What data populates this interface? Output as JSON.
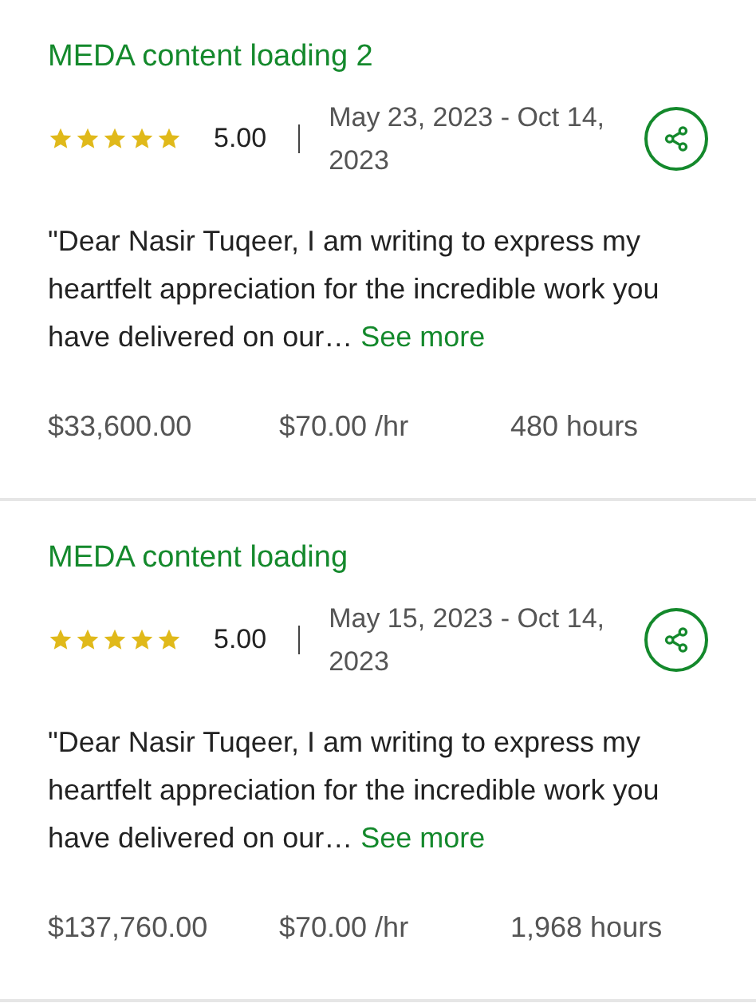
{
  "contracts": [
    {
      "title": "MEDA content loading 2",
      "stars": 5,
      "rating": "5.00",
      "dates": "May 23, 2023 - Oct 14, 2023",
      "feedback": "\"Dear Nasir Tuqeer, I am writing to express my heartfelt appreciation for the incredible work you have delivered on our…",
      "see_more": "See more",
      "earned": "$33,600.00",
      "rate": "$70.00 /hr",
      "hours": "480 hours"
    },
    {
      "title": "MEDA content loading",
      "stars": 5,
      "rating": "5.00",
      "dates": "May 15, 2023 - Oct 14, 2023",
      "feedback": "\"Dear Nasir Tuqeer, I am writing to express my heartfelt appreciation for the incredible work you have delivered on our…",
      "see_more": "See more",
      "earned": "$137,760.00",
      "rate": "$70.00 /hr",
      "hours": "1,968 hours"
    }
  ]
}
